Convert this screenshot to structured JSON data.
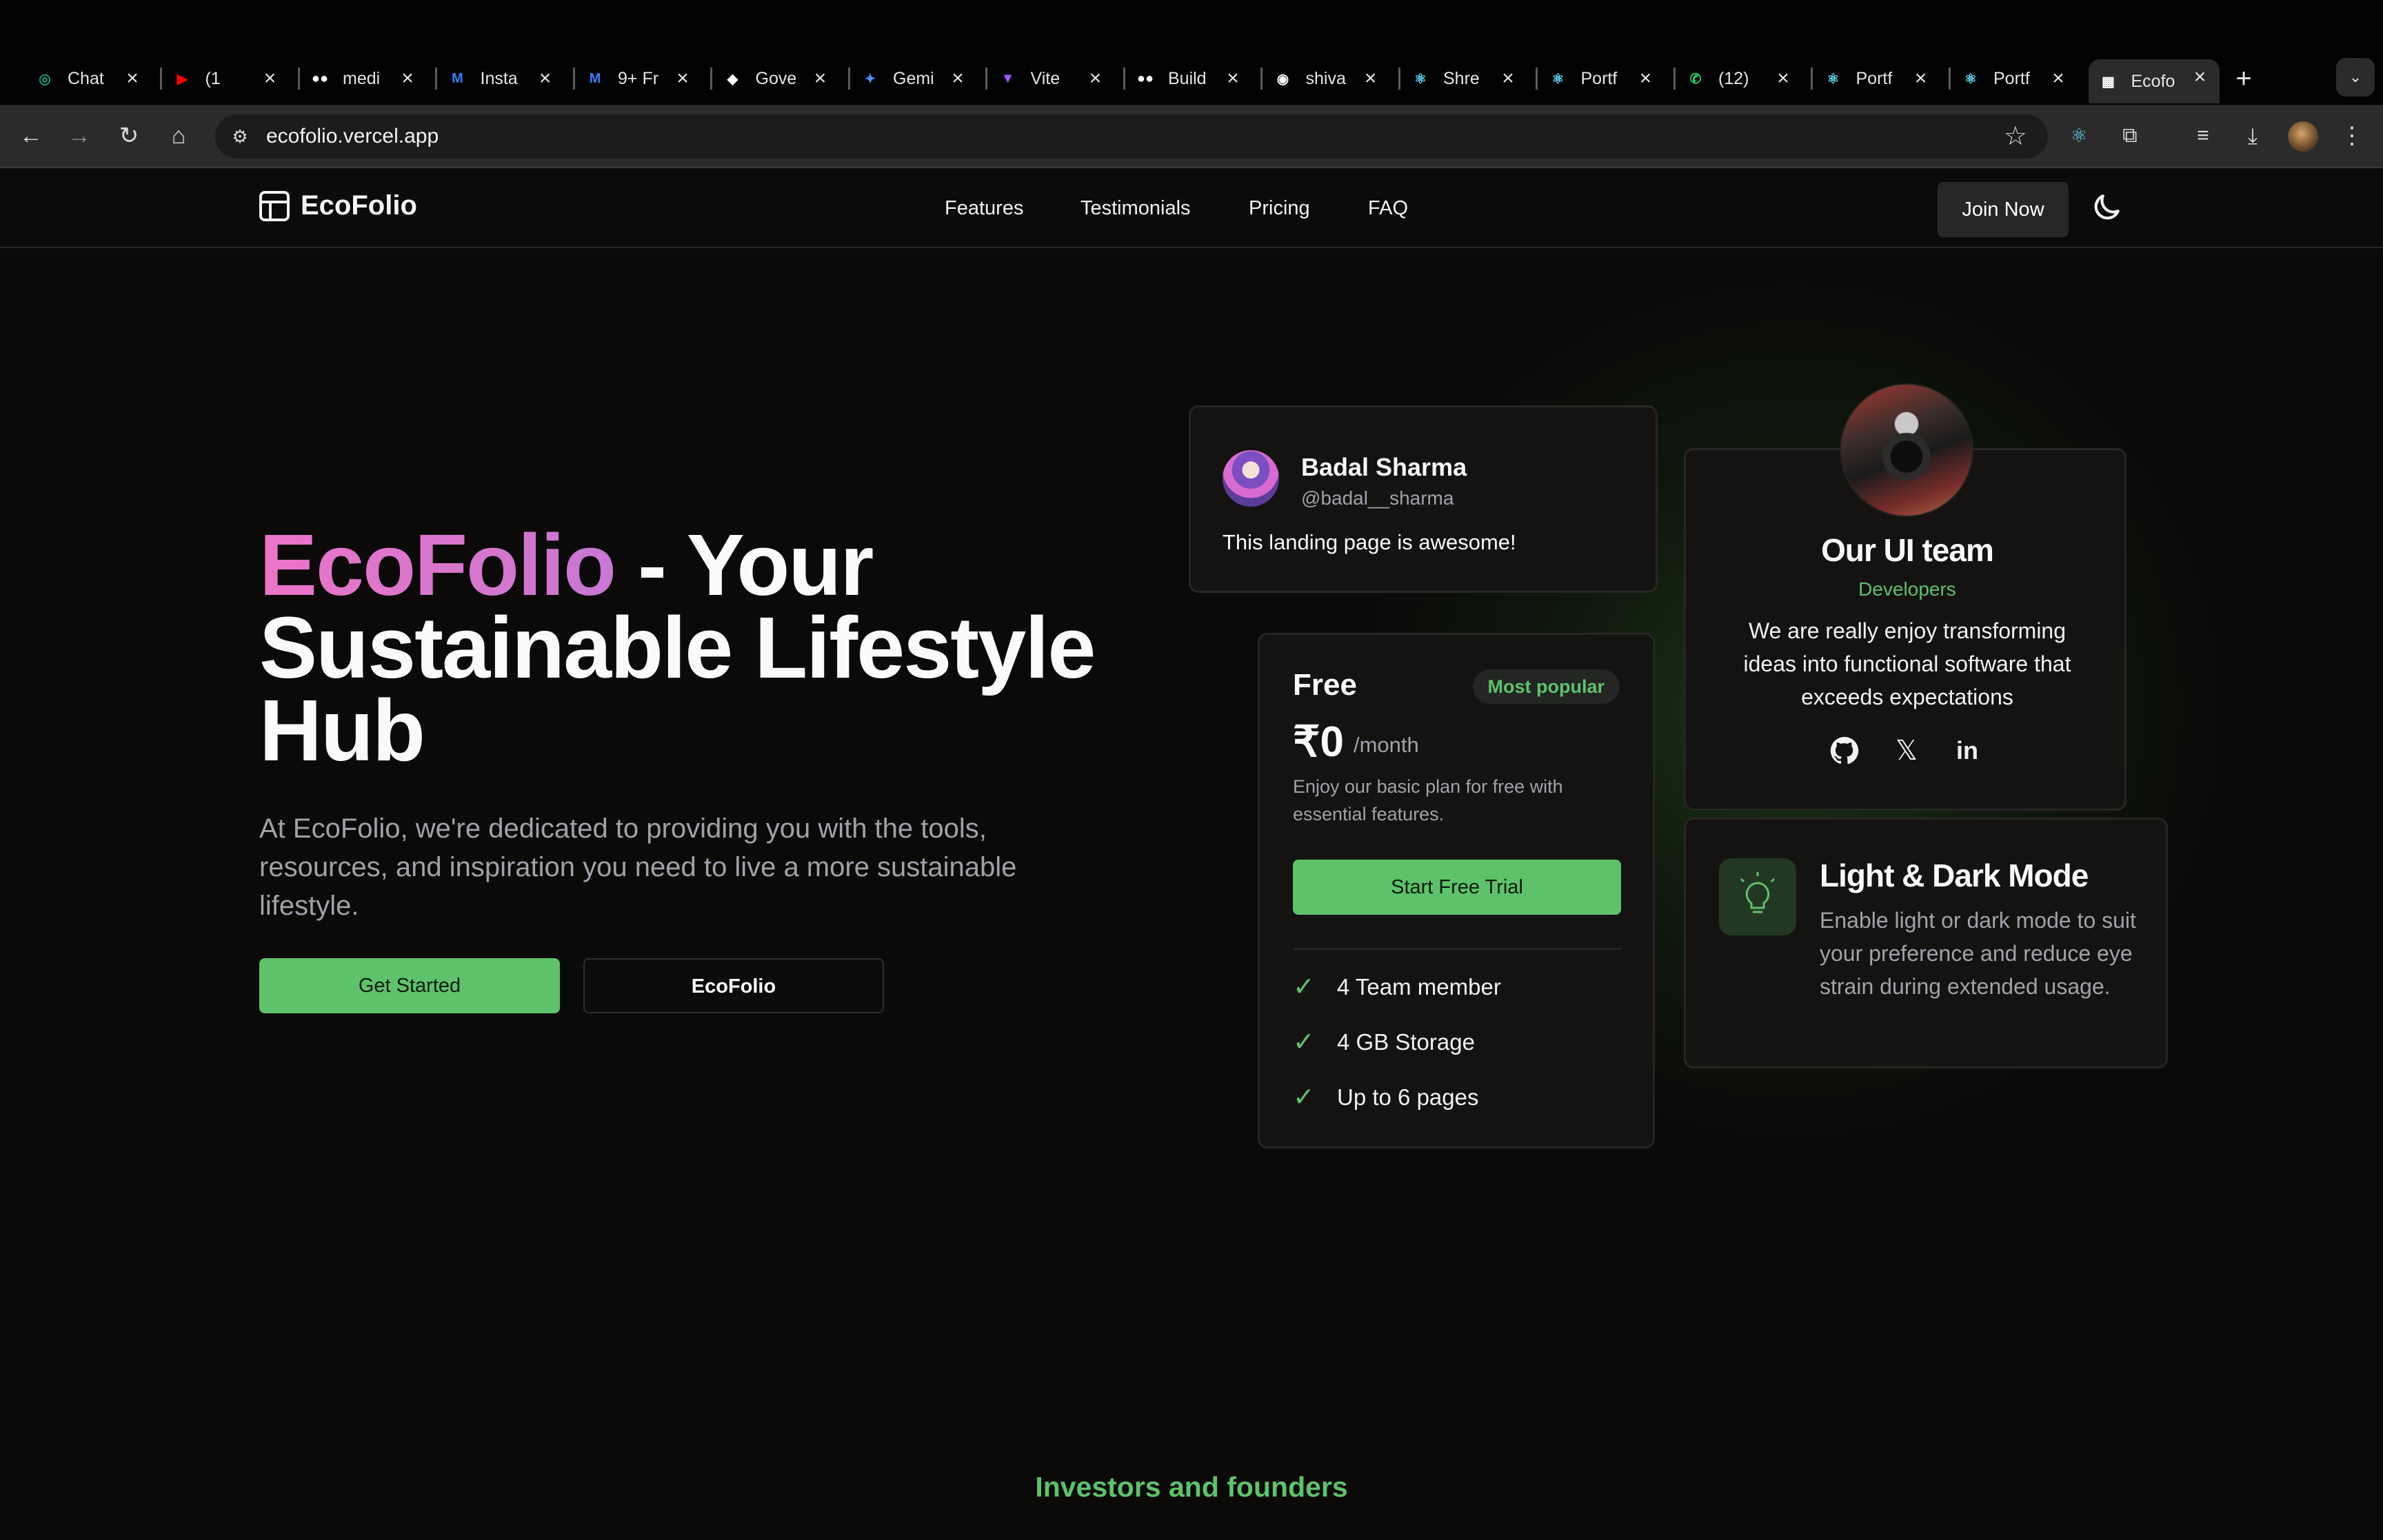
{
  "browser": {
    "tabs": [
      {
        "title": "Chat",
        "icon": "chatgpt-icon",
        "color": "#10a37f"
      },
      {
        "title": "(1",
        "icon": "youtube-icon",
        "color": "#ff0000"
      },
      {
        "title": "medi",
        "icon": "medium-icon",
        "color": "#ffffff"
      },
      {
        "title": "Insta",
        "icon": "mui-icon",
        "color": "#3d7bfd"
      },
      {
        "title": "9+ Fr",
        "icon": "mui-icon",
        "color": "#3d7bfd"
      },
      {
        "title": "Gove",
        "icon": "gov-icon",
        "color": "#ffffff"
      },
      {
        "title": "Gemi",
        "icon": "gemini-icon",
        "color": "#4e8df5"
      },
      {
        "title": "Vite",
        "icon": "vite-icon",
        "color": "#a259ff"
      },
      {
        "title": "Build",
        "icon": "medium-icon",
        "color": "#ffffff"
      },
      {
        "title": "shiva",
        "icon": "github-icon",
        "color": "#ffffff"
      },
      {
        "title": "Shre",
        "icon": "react-icon",
        "color": "#61dafb"
      },
      {
        "title": "Portf",
        "icon": "react-icon",
        "color": "#61dafb"
      },
      {
        "title": "(12)",
        "icon": "whatsapp-icon",
        "color": "#25d366"
      },
      {
        "title": "Portf",
        "icon": "react-icon",
        "color": "#61dafb"
      },
      {
        "title": "Portf",
        "icon": "react-icon",
        "color": "#61dafb"
      },
      {
        "title": "Ecofo",
        "icon": "layout-icon",
        "color": "#ffffff",
        "active": true
      }
    ],
    "url": "ecofolio.vercel.app"
  },
  "site": {
    "logo_text": "EcoFolio",
    "nav": [
      "Features",
      "Testimonials",
      "Pricing",
      "FAQ"
    ],
    "join_label": "Join Now"
  },
  "hero": {
    "title_brand": "EcoFolio",
    "title_rest": " - Your Sustainable Lifestyle Hub",
    "subtitle": "At EcoFolio, we're dedicated to providing you with the tools, resources, and inspiration you need to live a more sustainable lifestyle.",
    "primary_cta": "Get Started",
    "secondary_cta": "EcoFolio"
  },
  "testimonial": {
    "name": "Badal Sharma",
    "handle": "@badal__sharma",
    "text": "This landing page is awesome!"
  },
  "pricing": {
    "plan": "Free",
    "badge": "Most popular",
    "price": "₹0",
    "period": "/month",
    "description": "Enjoy our basic plan for free with essential features.",
    "cta": "Start Free Trial",
    "features": [
      "4 Team member",
      "4 GB Storage",
      "Up to 6 pages"
    ]
  },
  "team": {
    "title": "Our UI team",
    "role": "Developers",
    "description": "We are really enjoy transforming ideas into functional software that exceeds expectations"
  },
  "feature": {
    "title": "Light & Dark Mode",
    "description": "Enable light or dark mode to suit your preference and reduce eye strain during extended usage."
  },
  "investors_heading": "Investors and founders",
  "colors": {
    "accent_green": "#5ec26a",
    "brand_pink": "#ec74c8",
    "background": "#0b0a09"
  }
}
